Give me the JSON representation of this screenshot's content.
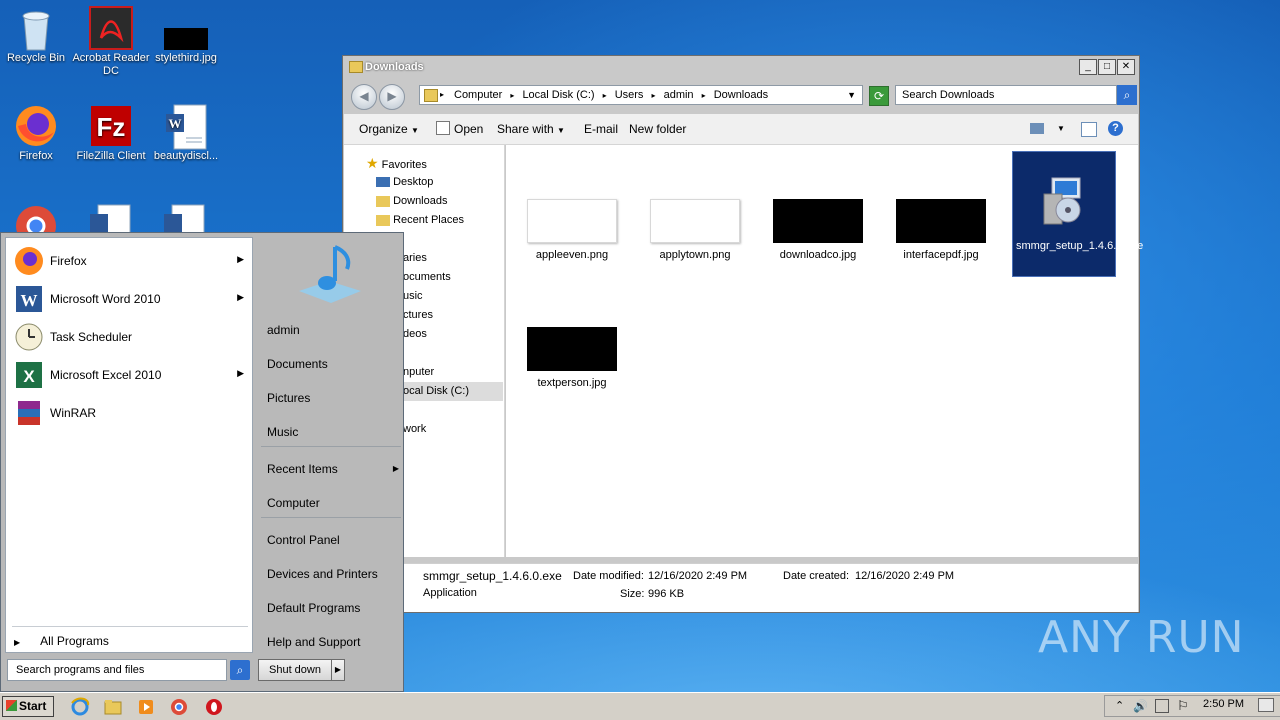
{
  "desktop": {
    "icons": [
      {
        "label": "Recycle Bin",
        "icon": "recycle-bin-icon"
      },
      {
        "label": "Acrobat Reader DC",
        "icon": "acrobat-icon"
      },
      {
        "label": "stylethird.jpg",
        "icon": "image-file-icon"
      },
      {
        "label": "Firefox",
        "icon": "firefox-icon"
      },
      {
        "label": "FileZilla Client",
        "icon": "filezilla-icon"
      },
      {
        "label": "beautydiscl...",
        "icon": "word-doc-icon"
      }
    ]
  },
  "explorer": {
    "title": "Downloads",
    "breadcrumb": [
      "Computer",
      "Local Disk (C:)",
      "Users",
      "admin",
      "Downloads"
    ],
    "search_placeholder": "Search Downloads",
    "toolbar": {
      "organize": "Organize",
      "open": "Open",
      "share_with": "Share with",
      "email": "E-mail",
      "new_folder": "New folder"
    },
    "nav": {
      "favorites": "Favorites",
      "desktop": "Desktop",
      "downloads": "Downloads",
      "recent_places": "Recent Places",
      "libraries": "aries",
      "documents": "ocuments",
      "music": "usic",
      "pictures": "ctures",
      "videos": "deos",
      "computer": "nputer",
      "local_disk": "ocal Disk (C:)",
      "network": "work"
    },
    "files": [
      {
        "name": "appleeven.png",
        "thumb": "white"
      },
      {
        "name": "applytown.png",
        "thumb": "white"
      },
      {
        "name": "downloadco.jpg",
        "thumb": "black"
      },
      {
        "name": "interfacepdf.jpg",
        "thumb": "black"
      },
      {
        "name": "smmgr_setup_1.4.6.0.exe",
        "thumb": "installer"
      },
      {
        "name": "textperson.jpg",
        "thumb": "black"
      }
    ],
    "details": {
      "name": "smmgr_setup_1.4.6.0.exe",
      "type": "Application",
      "modified_label": "Date modified:",
      "modified": "12/16/2020 2:49 PM",
      "size_label": "Size:",
      "size": "996 KB",
      "created_label": "Date created:",
      "created": "12/16/2020 2:49 PM"
    }
  },
  "start_menu": {
    "programs": [
      {
        "label": "Firefox",
        "has_arrow": true
      },
      {
        "label": "Microsoft Word 2010",
        "has_arrow": true
      },
      {
        "label": "Task Scheduler",
        "has_arrow": false
      },
      {
        "label": "Microsoft Excel 2010",
        "has_arrow": true
      },
      {
        "label": "WinRAR",
        "has_arrow": false
      }
    ],
    "all_programs": "All Programs",
    "search_placeholder": "Search programs and files",
    "right_items": {
      "admin": "admin",
      "documents": "Documents",
      "pictures": "Pictures",
      "music": "Music",
      "recent_items": "Recent Items",
      "computer": "Computer",
      "control_panel": "Control Panel",
      "devices_printers": "Devices and Printers",
      "default_programs": "Default Programs",
      "help_support": "Help and Support"
    },
    "shutdown": "Shut down"
  },
  "taskbar": {
    "start": "Start",
    "clock": "2:50 PM"
  },
  "watermark": "ANY RUN"
}
